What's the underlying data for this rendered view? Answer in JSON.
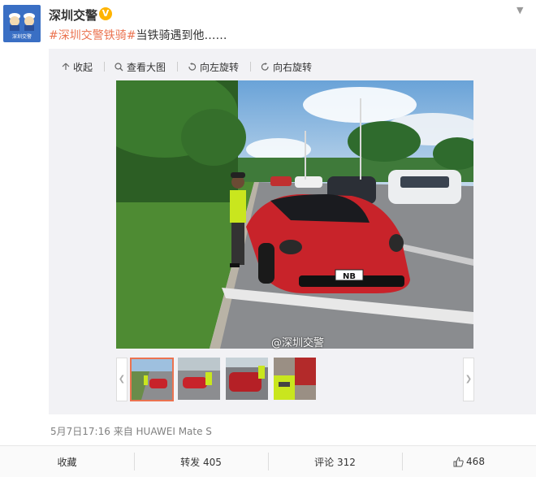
{
  "user": {
    "name": "深圳交警",
    "verified_badge": "V",
    "avatar_caption": "深圳交警"
  },
  "post": {
    "hashtag": "#深圳交警铁骑#",
    "text": "当铁骑遇到他……"
  },
  "toolbar": {
    "collapse": "收起",
    "view_large": "查看大图",
    "rotate_left": "向左旋转",
    "rotate_right": "向右旋转"
  },
  "photo": {
    "plate": "NB",
    "watermark": "@深圳交警"
  },
  "thumbnails": {
    "count": 4,
    "selected_index": 0
  },
  "meta": {
    "time": "5月7日17:16",
    "from_label": "来自",
    "device": "HUAWEI Mate S"
  },
  "actions": {
    "favorite": "收藏",
    "repost": "转发 405",
    "comment": "评论 312",
    "like": "468"
  },
  "colors": {
    "hashtag": "#eb7350",
    "badge": "#ffb400",
    "car": "#c8232a"
  }
}
